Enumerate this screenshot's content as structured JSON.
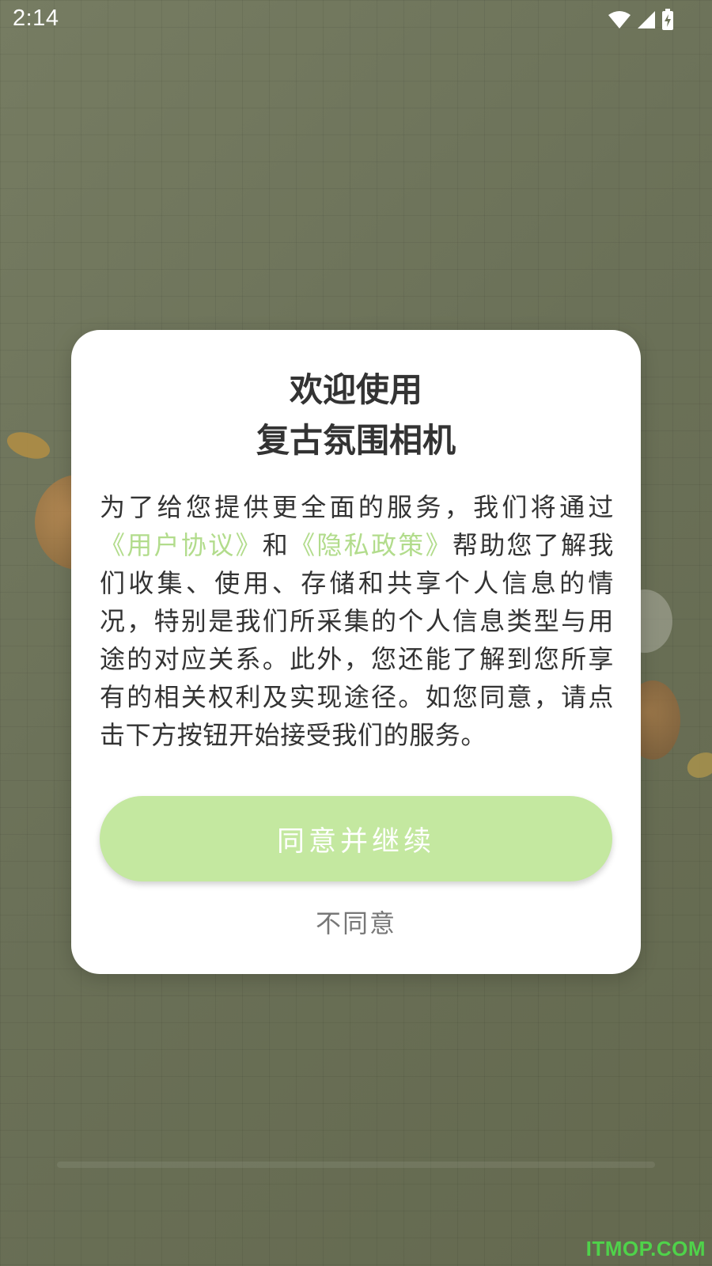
{
  "status_bar": {
    "time": "2:14",
    "icons": [
      "wifi-icon",
      "cellular-signal-icon",
      "battery-charging-icon"
    ]
  },
  "dialog": {
    "title_line1": "欢迎使用",
    "title_line2": "复古氛围相机",
    "body": {
      "part1": "为了给您提供更全面的服务，我们将通过",
      "link_user_agreement": "《用户协议》",
      "part2": "和",
      "link_privacy_policy": "《隐私政策》",
      "part3": "帮助您了解我们收集、使用、存储和共享个人信息的情况，特别是我们所采集的个人信息类型与用途的对应关系。此外，您还能了解到您所享有的相关权利及实现途径。如您同意，请点击下方按钮开始接受我们的服务。"
    },
    "agree_label": "同意并继续",
    "disagree_label": "不同意"
  },
  "watermark": "ITMOP.COM",
  "colors": {
    "link": "#b2dc8c",
    "agree_button_bg": "#c4e8a0",
    "text": "#333333",
    "disagree_text": "#777777",
    "background": "#6d7359"
  }
}
